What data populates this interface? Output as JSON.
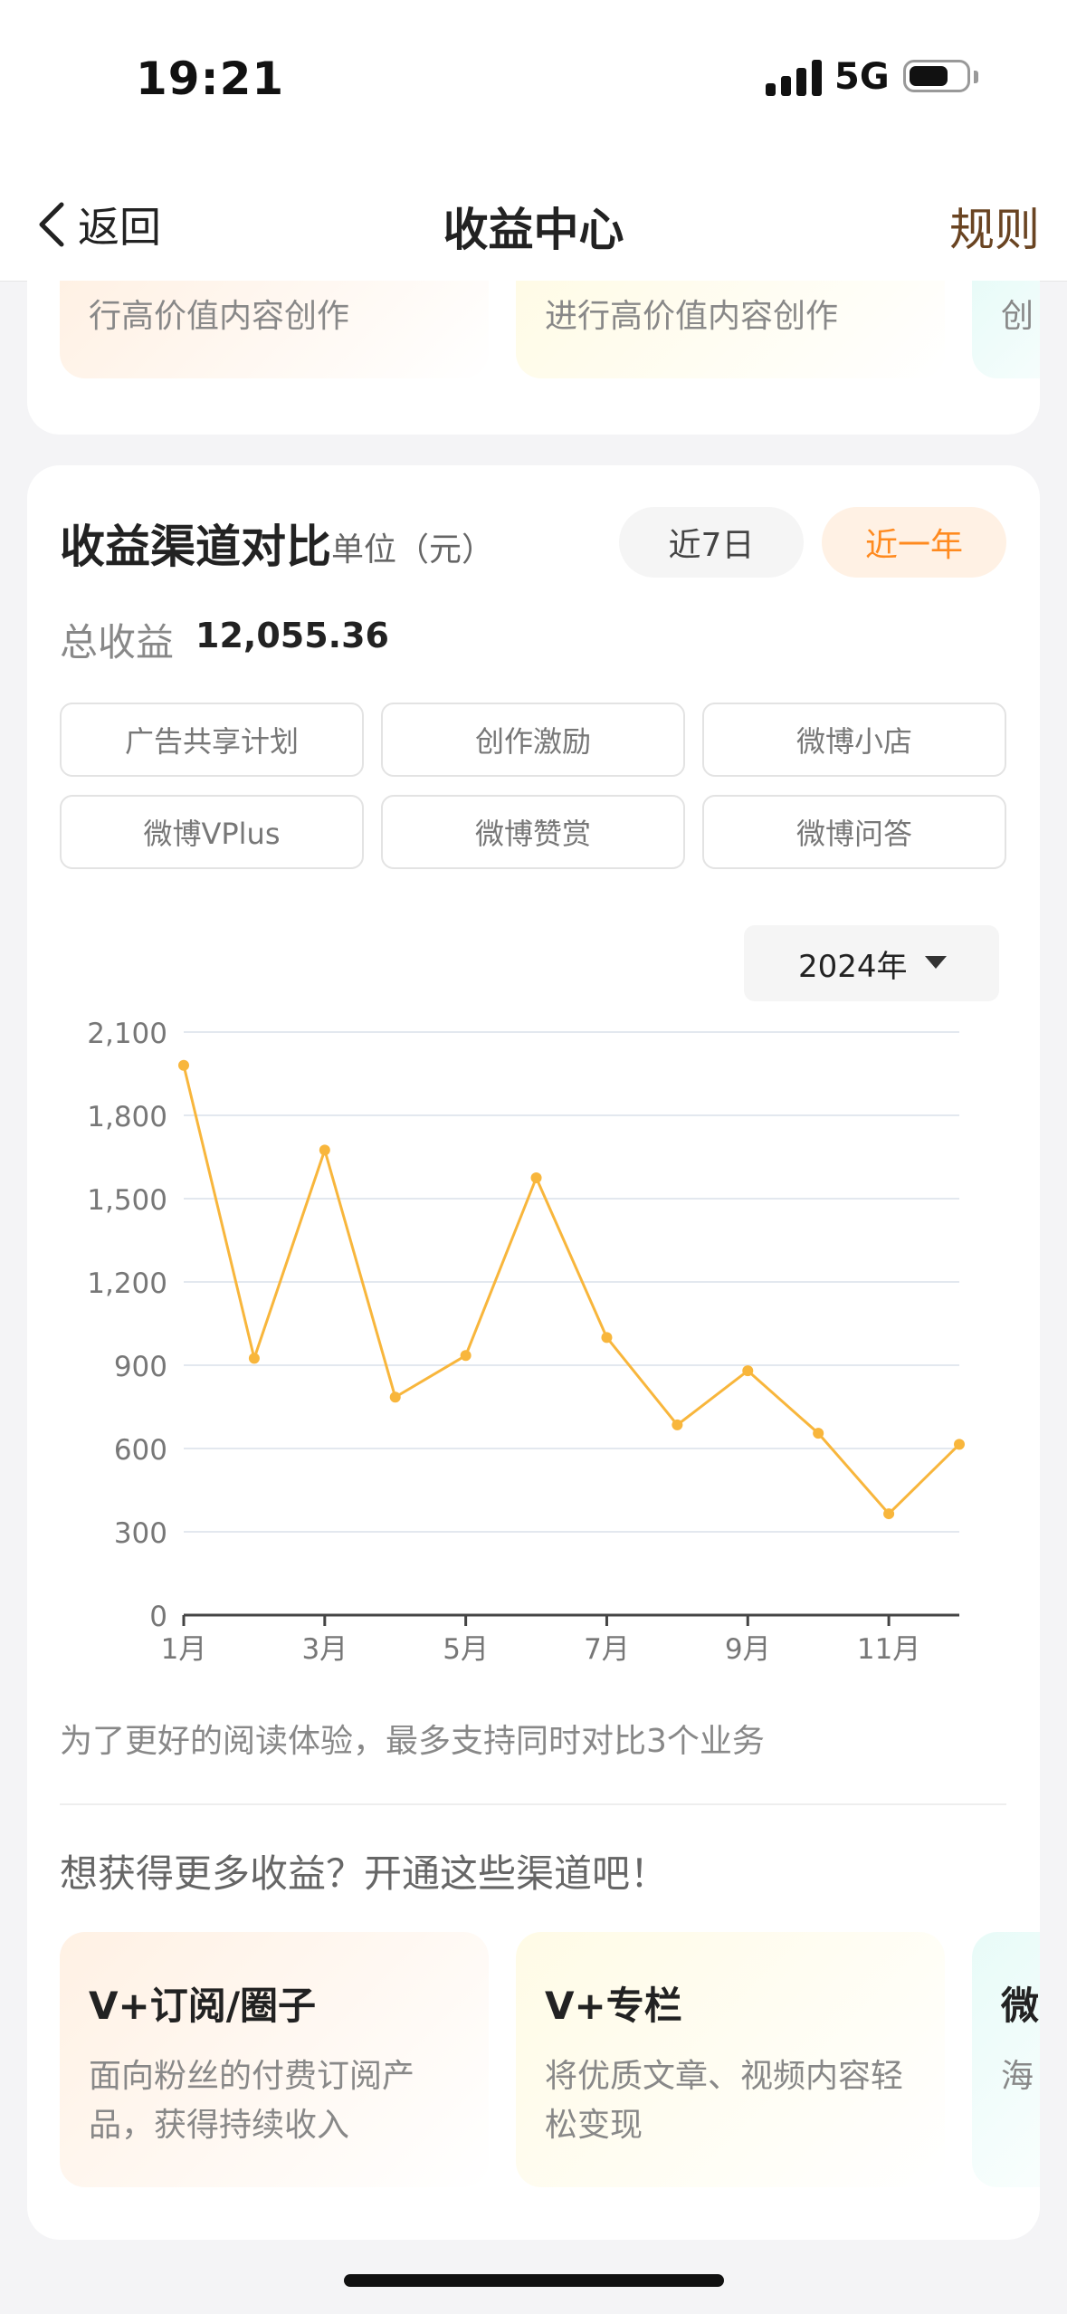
{
  "status_bar": {
    "time": "19:21",
    "network": "5G",
    "battery_percent": 70
  },
  "nav": {
    "back_label": "返回",
    "title": "收益中心",
    "rules_label": "规则"
  },
  "top_cards": [
    {
      "desc": "行高价值内容创作",
      "bg": "#fff1e4"
    },
    {
      "desc": "进行高价值内容创作",
      "bg": "#fffbe6"
    },
    {
      "desc": "创",
      "bg": "#e8fbf8"
    }
  ],
  "section": {
    "title": "收益渠道对比",
    "unit": "单位（元）",
    "range_options": [
      "近7日",
      "近一年"
    ],
    "range_selected": "近一年",
    "total_label": "总收益",
    "total_value": "12,055.36",
    "channels": [
      "广告共享计划",
      "创作激励",
      "微博小店",
      "微博VPlus",
      "微博赞赏",
      "微博问答"
    ],
    "year_selected": "2024年",
    "hint": "为了更好的阅读体验，最多支持同时对比3个业务",
    "more_title": "想获得更多收益？开通这些渠道吧！"
  },
  "chart_data": {
    "type": "line",
    "x": [
      1,
      2,
      3,
      4,
      5,
      6,
      7,
      8,
      9,
      10,
      11,
      12
    ],
    "x_tick_values": [
      1,
      3,
      5,
      7,
      9,
      11
    ],
    "x_tick_labels": [
      "1月",
      "3月",
      "5月",
      "7月",
      "9月",
      "11月"
    ],
    "y_ticks": [
      0,
      300,
      600,
      900,
      1200,
      1500,
      1800,
      2100
    ],
    "y_tick_labels": [
      "0",
      "300",
      "600",
      "900",
      "1,200",
      "1,500",
      "1,800",
      "2,100"
    ],
    "ylim": [
      0,
      2100
    ],
    "xlim": [
      1,
      12
    ],
    "grid": true,
    "series": [
      {
        "values": [
          1980,
          925,
          1675,
          785,
          935,
          1575,
          1000,
          685,
          880,
          655,
          365,
          615
        ],
        "color": "#f8b63c"
      }
    ]
  },
  "promos": [
    {
      "title": "V+订阅/圈子",
      "desc": "面向粉丝的付费订阅产品，获得持续收入",
      "bg": "#fff1e4"
    },
    {
      "title": "V+专栏",
      "desc": "将优质文章、视频内容轻松变现",
      "bg": "#fffbe6"
    },
    {
      "title": "微",
      "desc": "海",
      "bg": "#e8fbf8"
    }
  ]
}
